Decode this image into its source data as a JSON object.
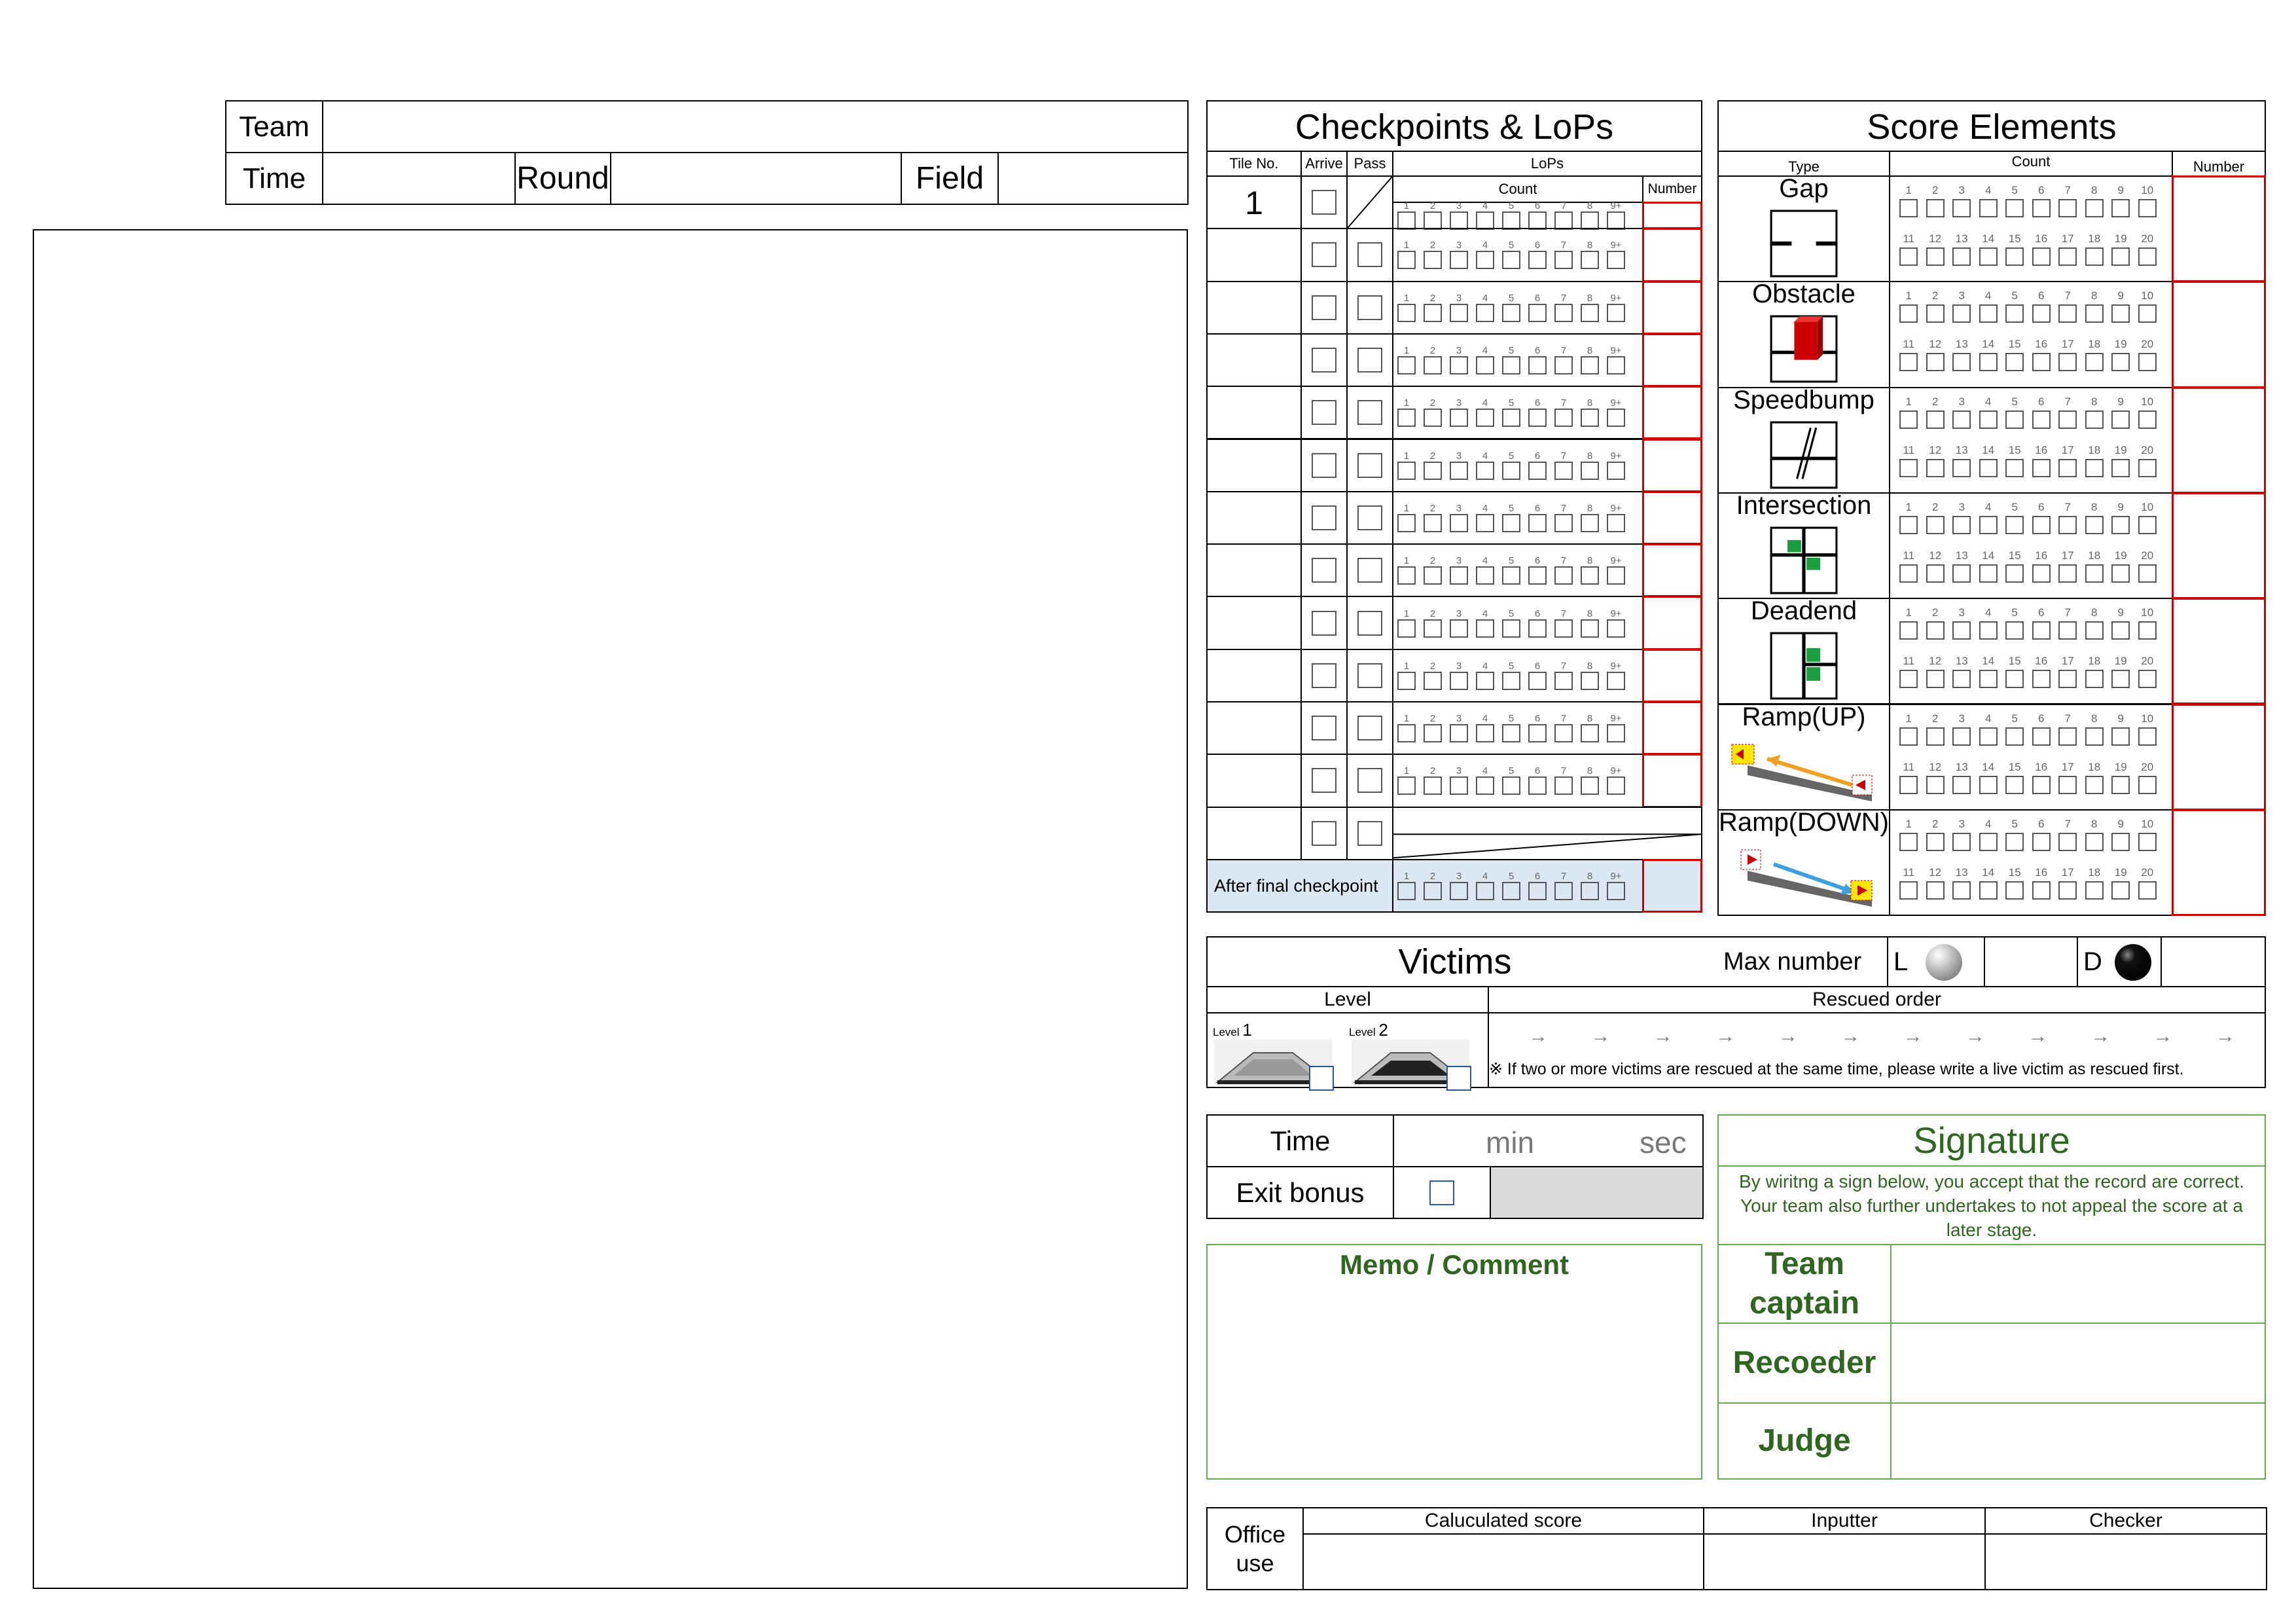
{
  "header": {
    "team_label": "Team",
    "time_label": "Time",
    "round_label": "Round",
    "field_label": "Field"
  },
  "checkpoints": {
    "title": "Checkpoints & LoPs",
    "col_tile": "Tile No.",
    "col_arrive": "Arrive",
    "col_pass": "Pass",
    "col_lops": "LoPs",
    "count_label": "Count",
    "number_label": "Number",
    "first_tile": "1",
    "count_nums": [
      "1",
      "2",
      "3",
      "4",
      "5",
      "6",
      "7",
      "8",
      "9+"
    ],
    "after_final": "After final checkpoint"
  },
  "score": {
    "title": "Score Elements",
    "col_type": "Type",
    "col_count": "Count",
    "col_number": "Number",
    "elements": [
      "Gap",
      "Obstacle",
      "Speedbump",
      "Intersection",
      "Deadend",
      "Ramp(UP)",
      "Ramp(DOWN)"
    ],
    "nums_row1": [
      "1",
      "2",
      "3",
      "4",
      "5",
      "6",
      "7",
      "8",
      "9",
      "10"
    ],
    "nums_row2": [
      "11",
      "12",
      "13",
      "14",
      "15",
      "16",
      "17",
      "18",
      "19",
      "20"
    ]
  },
  "victims": {
    "title": "Victims",
    "max_label": "Max number",
    "live_label": "L",
    "dead_label": "D",
    "level_label": "Level",
    "rescued_label": "Rescued order",
    "level1": "Level 1",
    "level2": "Level 2",
    "level1_prefix": "Level",
    "level1_num": "1",
    "level2_prefix": "Level",
    "level2_num": "2",
    "arrows": [
      "→",
      "→",
      "→",
      "→",
      "→",
      "→",
      "→",
      "→",
      "→",
      "→",
      "→",
      "→"
    ],
    "note": "※ If two or more victims are rescued at the same time, please write a live victim as rescued first."
  },
  "time": {
    "label": "Time",
    "min": "min",
    "sec": "sec",
    "exit_label": "Exit bonus"
  },
  "signature": {
    "title": "Signature",
    "text": "By wiritng a sign below, you accept that the record are correct. Your team also further undertakes to not appeal the score at a later stage.",
    "captain": "Team captain",
    "recorder": "Recoeder",
    "judge": "Judge"
  },
  "memo": {
    "title": "Memo / Comment"
  },
  "office": {
    "label": "Office use",
    "calc": "Caluculated score",
    "inputter": "Inputter",
    "checker": "Checker"
  },
  "colors": {
    "red": "#cc0000",
    "green": "#2f6620",
    "after_bg": "#dbe8f4",
    "exit_bg": "#d9d9d9"
  }
}
